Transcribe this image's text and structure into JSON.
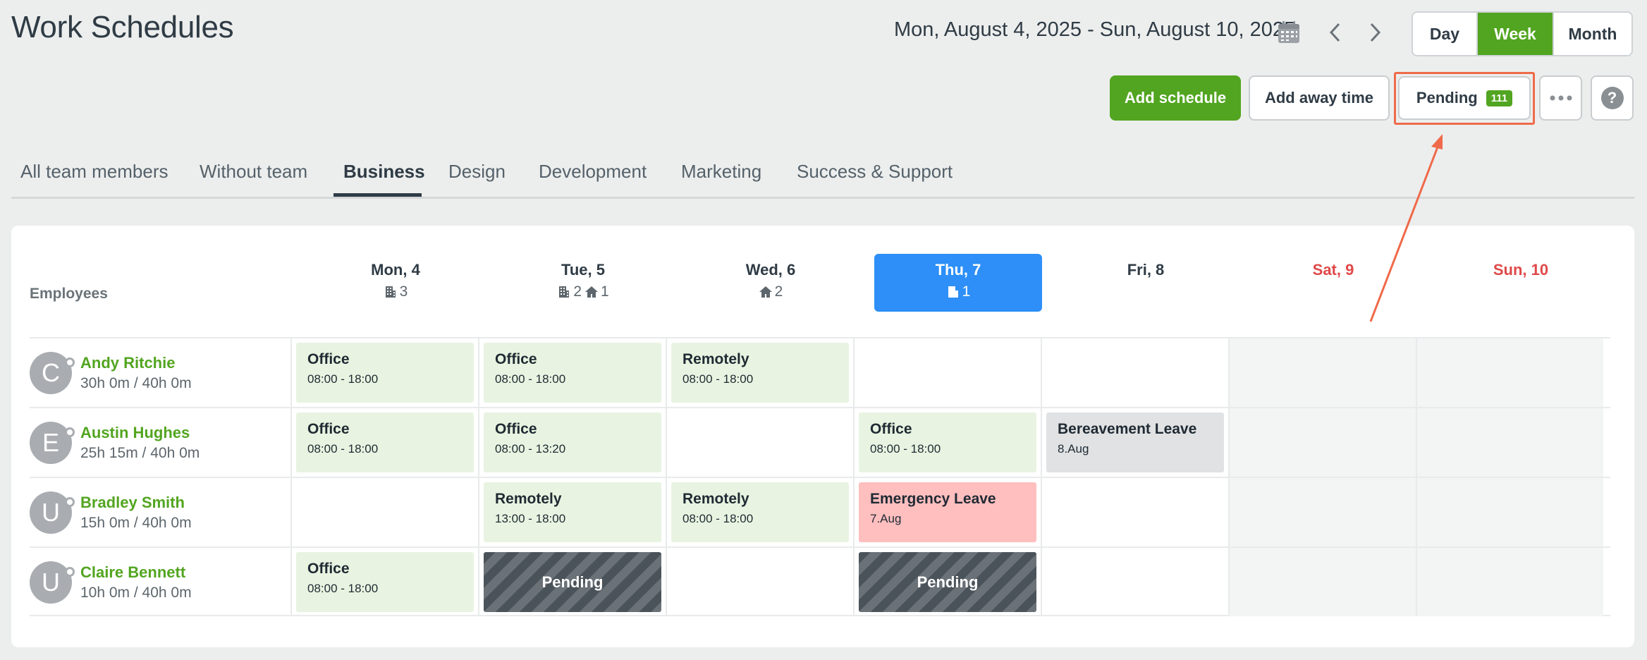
{
  "header": {
    "title": "Work Schedules",
    "date_range": "Mon, August 4, 2025 - Sun, August 10, 2025",
    "view_options": [
      "Day",
      "Week",
      "Month"
    ],
    "active_view": "Week"
  },
  "actions": {
    "add_schedule": "Add schedule",
    "add_away_time": "Add away time",
    "pending_label": "Pending",
    "pending_count": "111"
  },
  "tabs": [
    {
      "label": "All team members"
    },
    {
      "label": "Without team"
    },
    {
      "label": "Business",
      "active": true
    },
    {
      "label": "Design"
    },
    {
      "label": "Development"
    },
    {
      "label": "Marketing"
    },
    {
      "label": "Success & Support"
    }
  ],
  "grid": {
    "employees_header": "Employees",
    "days": [
      {
        "label": "Mon, 4",
        "office": "3",
        "home": ""
      },
      {
        "label": "Tue, 5",
        "office": "2",
        "home": "1"
      },
      {
        "label": "Wed, 6",
        "office": "",
        "home": "2"
      },
      {
        "label": "Thu, 7",
        "office": "1",
        "home": "",
        "today": true
      },
      {
        "label": "Fri, 8",
        "office": "",
        "home": ""
      },
      {
        "label": "Sat, 9",
        "office": "",
        "home": "",
        "weekend": true
      },
      {
        "label": "Sun, 10",
        "office": "",
        "home": "",
        "weekend": true
      }
    ],
    "employees": [
      {
        "initial": "C",
        "name": "Andy Ritchie",
        "hours": "30h 0m / 40h 0m",
        "shifts": [
          {
            "type": "office",
            "title": "Office",
            "detail": "08:00 - 18:00"
          },
          {
            "type": "office",
            "title": "Office",
            "detail": "08:00 - 18:00"
          },
          {
            "type": "office",
            "title": "Remotely",
            "detail": "08:00 - 18:00"
          },
          null,
          null,
          null,
          null
        ]
      },
      {
        "initial": "E",
        "name": "Austin Hughes",
        "hours": "25h 15m / 40h 0m",
        "shifts": [
          {
            "type": "office",
            "title": "Office",
            "detail": "08:00 - 18:00"
          },
          {
            "type": "office",
            "title": "Office",
            "detail": "08:00 - 13:20"
          },
          null,
          {
            "type": "office",
            "title": "Office",
            "detail": "08:00 - 18:00"
          },
          {
            "type": "leave-grey",
            "title": "Bereavement Leave",
            "detail": "8.Aug"
          },
          null,
          null
        ]
      },
      {
        "initial": "U",
        "name": "Bradley Smith",
        "hours": "15h 0m / 40h 0m",
        "shifts": [
          null,
          {
            "type": "office",
            "title": "Remotely",
            "detail": "13:00 - 18:00"
          },
          {
            "type": "office",
            "title": "Remotely",
            "detail": "08:00 - 18:00"
          },
          {
            "type": "leave-red",
            "title": "Emergency Leave",
            "detail": "7.Aug"
          },
          null,
          null,
          null
        ]
      },
      {
        "initial": "U",
        "name": "Claire Bennett",
        "hours": "10h 0m / 40h 0m",
        "shifts": [
          {
            "type": "office",
            "title": "Office",
            "detail": "08:00 - 18:00"
          },
          {
            "type": "pending",
            "title": "Pending"
          },
          null,
          {
            "type": "pending",
            "title": "Pending"
          },
          null,
          null,
          null
        ]
      }
    ]
  },
  "colors": {
    "accent_green": "#52a520",
    "today_blue": "#2d8ff7",
    "weekend_red": "#e04848",
    "annotation_orange": "#ef6a4a"
  }
}
